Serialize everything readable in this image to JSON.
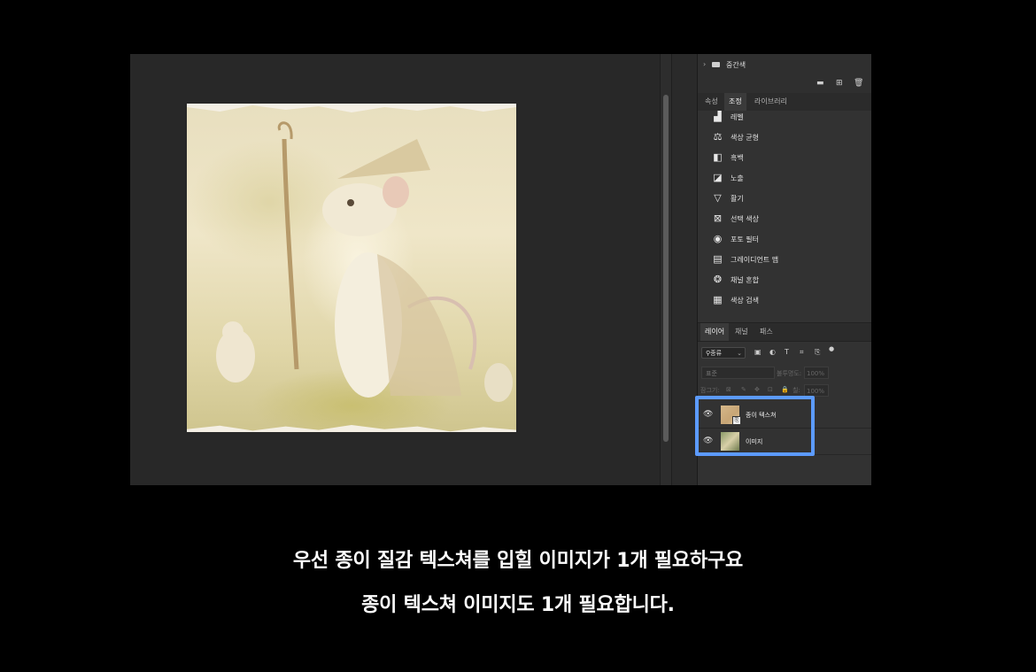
{
  "panel": {
    "group": {
      "chevron": "›",
      "folder_icon": "folder-icon",
      "label": "중간색"
    },
    "group_actions": {
      "new_folder_icon": "▬",
      "new_layer_icon": "⊞",
      "delete_icon": "🗑"
    },
    "adjust_tabs": [
      {
        "label": "속성",
        "active": false
      },
      {
        "label": "조정",
        "active": true
      },
      {
        "label": "라이브러리",
        "active": false
      }
    ],
    "adjustments": [
      {
        "icon": "levels-icon",
        "glyph": "▟",
        "label": "레벨"
      },
      {
        "icon": "color-balance-icon",
        "glyph": "⚖",
        "label": "색상 균형"
      },
      {
        "icon": "black-white-icon",
        "glyph": "◧",
        "label": "흑백"
      },
      {
        "icon": "exposure-icon",
        "glyph": "◪",
        "label": "노출"
      },
      {
        "icon": "vibrance-icon",
        "glyph": "▽",
        "label": "활기"
      },
      {
        "icon": "selective-color-icon",
        "glyph": "⊠",
        "label": "선택 색상"
      },
      {
        "icon": "photo-filter-icon",
        "glyph": "◉",
        "label": "포토 필터"
      },
      {
        "icon": "gradient-map-icon",
        "glyph": "▤",
        "label": "그레이디언트 맵"
      },
      {
        "icon": "channel-mixer-icon",
        "glyph": "❂",
        "label": "채널 혼합"
      },
      {
        "icon": "color-lookup-icon",
        "glyph": "▦",
        "label": "색상 검색"
      }
    ],
    "layer_tabs": [
      {
        "label": "레이어",
        "active": true
      },
      {
        "label": "채널",
        "active": false
      },
      {
        "label": "패스",
        "active": false
      }
    ],
    "filter": {
      "search_glyph": "⚲",
      "kind_label": "종류",
      "chevron": "⌄"
    },
    "filter_icons": [
      "▣",
      "◐",
      "T",
      "⌗",
      "⎘",
      "●"
    ],
    "blend_mode": "표준",
    "opacity_label": "불투명도:",
    "opacity_value": "100%",
    "lock_label": "잠그기:",
    "lock_icons": [
      "⊠",
      "✎",
      "✥",
      "⊡",
      "🔒"
    ],
    "fill_label": "칠:",
    "fill_value": "100%",
    "layers": [
      {
        "name": "종이 텍스쳐",
        "visible_glyph": "👁",
        "smart_object_glyph": "⎘"
      },
      {
        "name": "이미지",
        "visible_glyph": "👁"
      }
    ]
  },
  "captions": {
    "line1": "우선 종이 질감 텍스쳐를 입힐 이미지가 1개 필요하구요",
    "line2": "종이 텍스쳐 이미지도 1개 필요합니다."
  },
  "colors": {
    "highlight": "#5c9bff",
    "panel_bg": "#323232",
    "canvas_bg": "#282828"
  }
}
